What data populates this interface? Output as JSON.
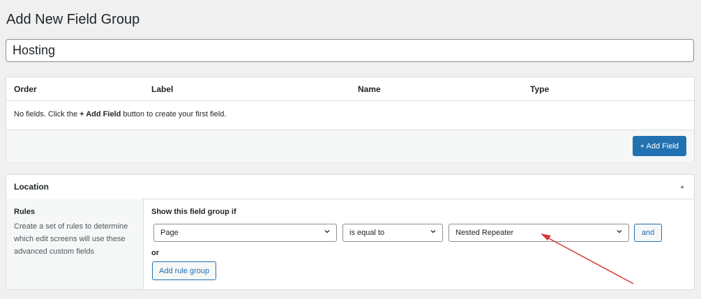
{
  "page": {
    "title": "Add New Field Group"
  },
  "field_group": {
    "title_value": "Hosting"
  },
  "fields_table": {
    "columns": [
      "Order",
      "Label",
      "Name",
      "Type"
    ],
    "empty_prefix": "No fields. Click the ",
    "empty_button_ref": "+ Add Field",
    "empty_suffix": " button to create your first field.",
    "add_field_label": "+ Add Field"
  },
  "location": {
    "title": "Location",
    "toggle_icon": "triangle-up-icon",
    "rules_title": "Rules",
    "rules_description": "Create a set of rules to determine which edit screens will use these advanced custom fields",
    "show_if_label": "Show this field group if",
    "rule": {
      "param": "Page",
      "operator": "is equal to",
      "value": "Nested Repeater"
    },
    "and_label": "and",
    "or_label": "or",
    "add_rule_group_label": "Add rule group"
  },
  "annotation": {
    "arrow_color": "#d63638"
  }
}
